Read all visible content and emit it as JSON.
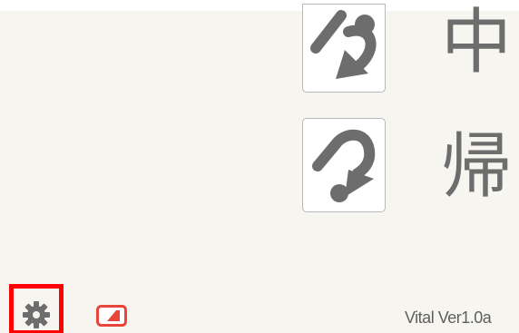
{
  "actions": {
    "interrupt": {
      "label": "中",
      "icon": "interrupt-arrow-icon"
    },
    "return": {
      "label": "帰",
      "icon": "return-arrow-icon"
    }
  },
  "footer": {
    "settings_icon": "gear-icon",
    "screen_icon": "screen-toggle-icon",
    "version": "Vital Ver1.0a"
  },
  "colors": {
    "background": "#f6f5f0",
    "icon_gray": "#6d6d6d",
    "highlight": "#ff0000",
    "screen_icon": "#e8463a"
  }
}
